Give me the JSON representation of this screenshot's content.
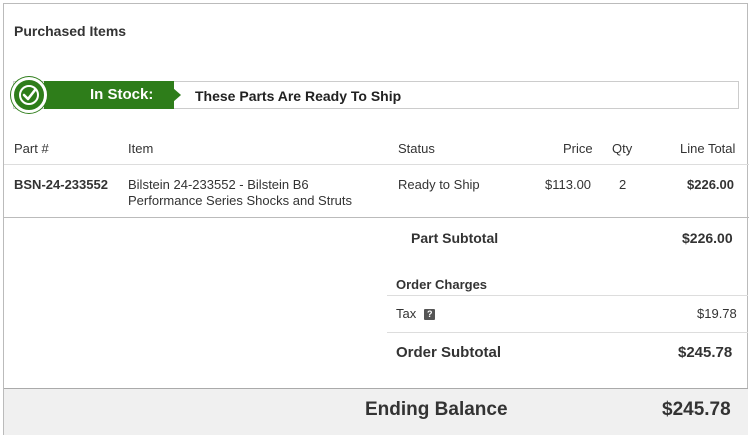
{
  "section_title": "Purchased Items",
  "stock": {
    "label": "In Stock:",
    "message": "These Parts Are Ready To Ship"
  },
  "table": {
    "headers": [
      "Part #",
      "Item",
      "Status",
      "Price",
      "Qty",
      "Line Total"
    ],
    "rows": [
      {
        "part": "BSN-24-233552",
        "item_line1": "Bilstein 24-233552 - Bilstein B6",
        "item_line2": "Performance Series Shocks and Struts",
        "status": "Ready to Ship",
        "price": "$113.00",
        "qty": "2",
        "line_total": "$226.00"
      }
    ]
  },
  "summary": {
    "part_subtotal_label": "Part Subtotal",
    "part_subtotal_value": "$226.00",
    "order_charges_label": "Order Charges",
    "tax_label": "Tax",
    "tax_help": "?",
    "tax_value": "$19.78",
    "order_subtotal_label": "Order Subtotal",
    "order_subtotal_value": "$245.78",
    "ending_balance_label": "Ending Balance",
    "ending_balance_value": "$245.78"
  },
  "colors": {
    "accent_green": "#2e7d1a"
  }
}
